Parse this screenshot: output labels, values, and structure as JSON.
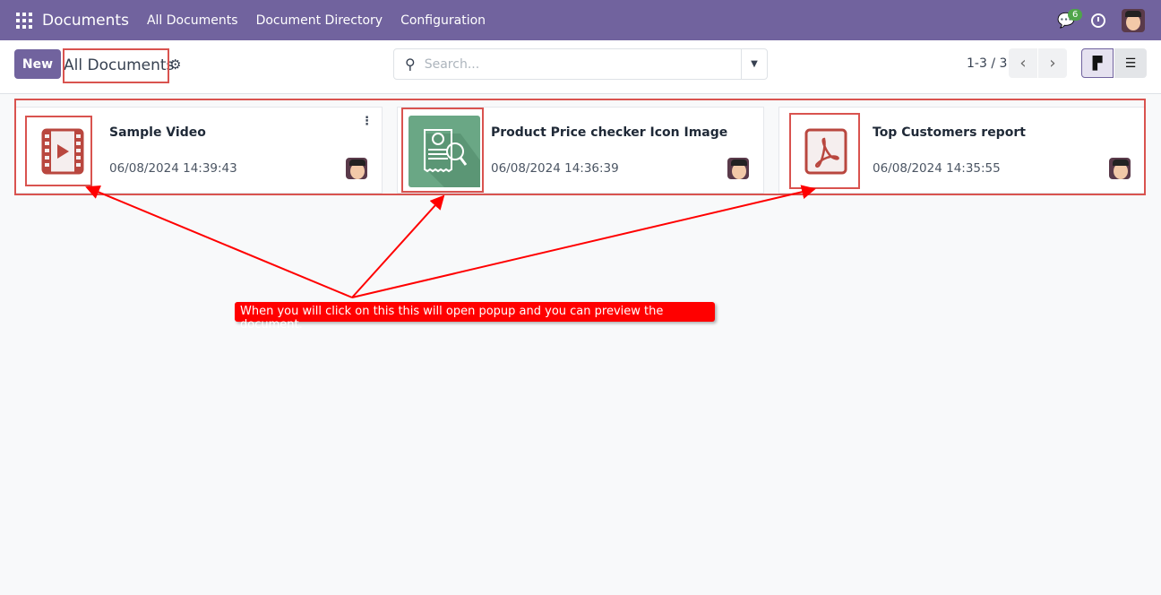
{
  "navbar": {
    "app": "Documents",
    "menus": [
      "All Documents",
      "Document Directory",
      "Configuration"
    ],
    "chat_count": "6"
  },
  "control": {
    "new_label": "New",
    "title": "All Documents",
    "search_placeholder": "Search...",
    "pager": "1-3 / 3"
  },
  "cards": [
    {
      "title": "Sample Video",
      "date": "06/08/2024 14:39:43",
      "icon": "video-icon"
    },
    {
      "title": "Product Price checker Icon Image",
      "date": "06/08/2024 14:36:39",
      "icon": "image-thumbnail"
    },
    {
      "title": "Top Customers report",
      "date": "06/08/2024 14:35:55",
      "icon": "pdf-icon"
    }
  ],
  "annotation": "When you will click on this this will open popup and you can preview the document.",
  "colors": {
    "brand": "#71639e",
    "annotation": "#ff0000"
  }
}
